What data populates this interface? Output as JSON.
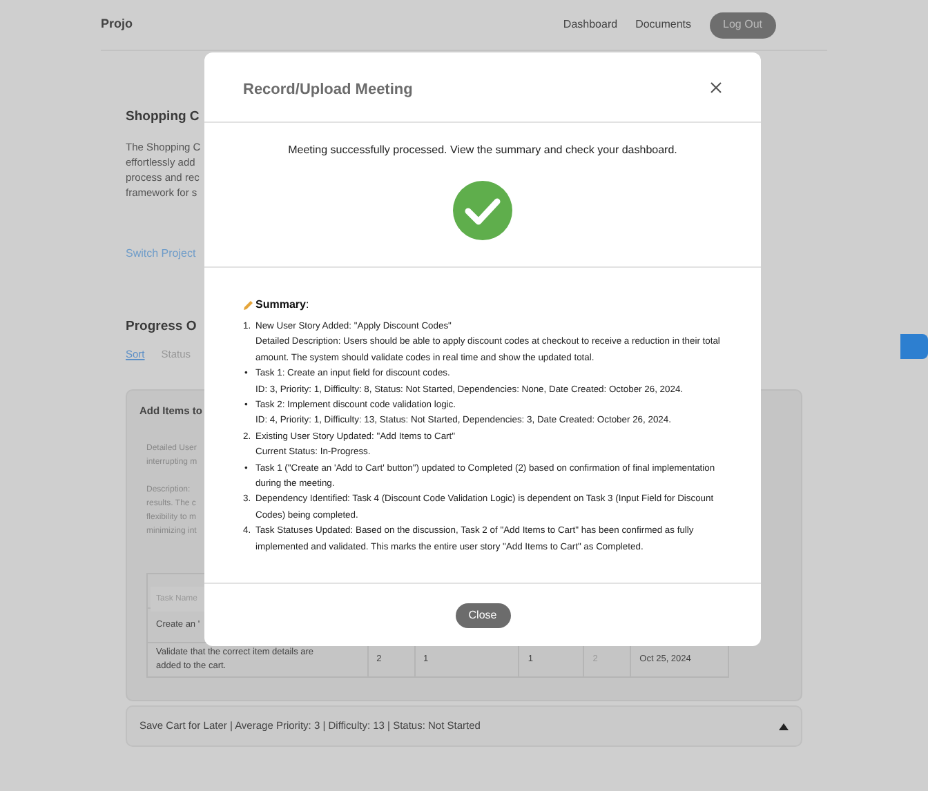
{
  "nav": {
    "brand": "Projo",
    "links": [
      {
        "label": "Dashboard"
      },
      {
        "label": "Documents"
      }
    ],
    "logout": "Log Out"
  },
  "page": {
    "title": "Shopping C",
    "intro_lines": [
      "The Shopping C",
      "effortlessly add",
      "process and rec",
      "framework for s"
    ],
    "switch_link": "Switch Project",
    "progress_title": "Progress O",
    "filters": [
      {
        "label": "Sort",
        "selected": true
      },
      {
        "label": "Status",
        "selected": false
      }
    ],
    "story_card": {
      "title": "Add Items to",
      "detail_lines": [
        "Detailed User",
        "interrupting m"
      ],
      "description_lines": [
        "Description:",
        "results. The c",
        "flexibility to m",
        "minimizing int"
      ],
      "table_rows": [
        {
          "kind": "input",
          "placeholder": "Task Name"
        },
        {
          "kind": "row",
          "cells": [
            "Create an '"
          ]
        },
        {
          "kind": "row",
          "cells": [
            "Validate that the correct item details are added to the cart.",
            "2",
            "1",
            "1",
            "2",
            "Oct 25, 2024"
          ]
        }
      ]
    },
    "collapsed_story": {
      "title": "Save Cart for Later | Average Priority: 3 | Difficulty: 13 | Status: Not Started",
      "expanded": false
    }
  },
  "modal": {
    "title": "Record/Upload Meeting",
    "message": "Meeting successfully processed. View the summary and check your dashboard.",
    "summary_label": "Summary",
    "summary_colon": ":",
    "items": [
      {
        "kind": "numbered",
        "marker": "1.",
        "title": "New User Story Added: \"Apply Discount Codes\"",
        "detail": "Detailed Description: Users should be able to apply discount codes at checkout to receive a reduction in their total amount. The system should validate codes in real time and show the updated total."
      },
      {
        "kind": "bullet",
        "marker": "•",
        "title": "Task 1: Create an input field for discount codes.",
        "detail": "ID: 3, Priority: 1, Difficulty: 8, Status: Not Started, Dependencies: None, Date Created: October 26, 2024."
      },
      {
        "kind": "bullet",
        "marker": "•",
        "title": "Task 2: Implement discount code validation logic.",
        "detail": "ID: 4, Priority: 1, Difficulty: 13, Status: Not Started, Dependencies: 3, Date Created: October 26, 2024."
      },
      {
        "kind": "numbered",
        "marker": "2.",
        "title": "Existing User Story Updated: \"Add Items to Cart\"",
        "detail": "Current Status: In-Progress."
      },
      {
        "kind": "bullet",
        "marker": "•",
        "title": "Task 1 (\"Create an 'Add to Cart' button\") updated to Completed (2) based on confirmation of final implementation during the meeting."
      },
      {
        "kind": "numbered",
        "marker": "3.",
        "title": "Dependency Identified: Task 4 (Discount Code Validation Logic) is dependent on Task 3 (Input Field for Discount Codes) being completed."
      },
      {
        "kind": "numbered",
        "marker": "4.",
        "title": "Task Statuses Updated: Based on the discussion, Task 2 of \"Add Items to Cart\" has been confirmed as fully implemented and validated. This marks the entire user story \"Add Items to Cart\" as Completed."
      }
    ],
    "close_button": "Close"
  }
}
